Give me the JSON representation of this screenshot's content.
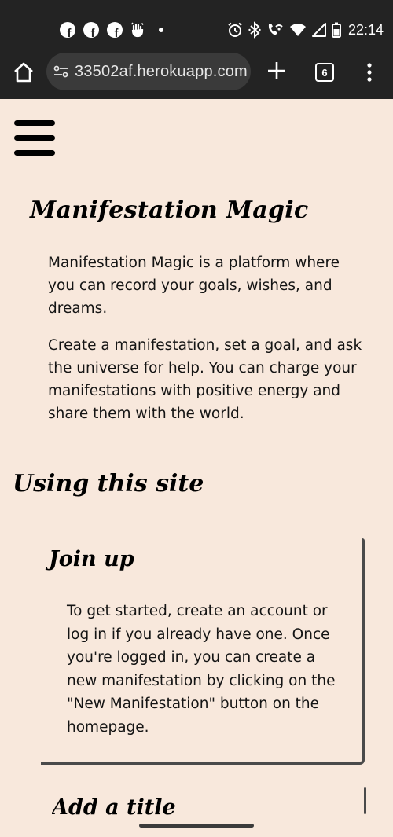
{
  "status_bar": {
    "time": "22:14",
    "notification_icons": [
      "facebook-icon",
      "facebook-icon",
      "facebook-icon",
      "hand-icon",
      "dot-icon"
    ],
    "system_icons": [
      "alarm-icon",
      "bluetooth-icon",
      "wifi-calling-icon",
      "wifi-icon",
      "signal-icon",
      "battery-icon"
    ],
    "fb_glyph": "f"
  },
  "browser": {
    "url": "33502af.herokuapp.com",
    "tab_count": "6"
  },
  "page": {
    "site_title": "Manifestation Magic",
    "intro_paragraph_1": "Manifestation Magic is a platform where you can record your goals, wishes, and dreams.",
    "intro_paragraph_2": "Create a manifestation, set a goal, and ask the universe for help. You can charge your manifestations with positive energy and share them with the world.",
    "section_title": "Using this site",
    "cards": [
      {
        "title": "Join up",
        "text": "To get started, create an account or log in if you already have one. Once you're logged in, you can create a new manifestation by clicking on the \"New Manifestation\" button on the homepage."
      },
      {
        "title": "Add a title",
        "text": ""
      }
    ]
  },
  "colors": {
    "page_background": "#f8e8dc",
    "status_bar_background": "#232323",
    "url_pill_background": "#3a3a3a",
    "card_border": "#4a4a4a"
  }
}
